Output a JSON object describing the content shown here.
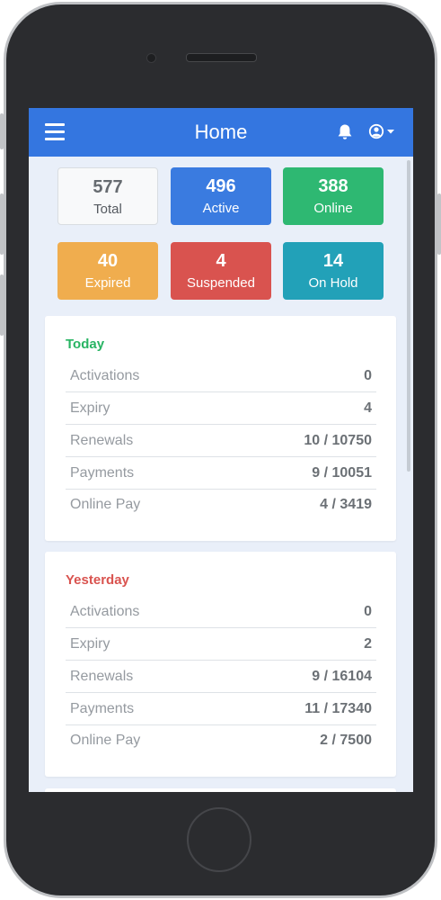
{
  "header": {
    "title": "Home"
  },
  "stats": [
    {
      "value": "577",
      "label": "Total"
    },
    {
      "value": "496",
      "label": "Active"
    },
    {
      "value": "388",
      "label": "Online"
    },
    {
      "value": "40",
      "label": "Expired"
    },
    {
      "value": "4",
      "label": "Suspended"
    },
    {
      "value": "14",
      "label": "On Hold"
    }
  ],
  "colors": {
    "navbar": "#3476e0",
    "active": "#3a7be0",
    "online": "#2eb872",
    "expired": "#f0ad4e",
    "suspended": "#d9534f",
    "on_hold": "#22a1b8",
    "today_title": "#28b463",
    "yesterday_title": "#d9534f"
  },
  "today": {
    "title": "Today",
    "rows": [
      {
        "label": "Activations",
        "value": "0"
      },
      {
        "label": "Expiry",
        "value": "4"
      },
      {
        "label": "Renewals",
        "value": "10 / 10750"
      },
      {
        "label": "Payments",
        "value": "9 / 10051"
      },
      {
        "label": "Online Pay",
        "value": "4 / 3419"
      }
    ]
  },
  "yesterday": {
    "title": "Yesterday",
    "rows": [
      {
        "label": "Activations",
        "value": "0"
      },
      {
        "label": "Expiry",
        "value": "2"
      },
      {
        "label": "Renewals",
        "value": "9 / 16104"
      },
      {
        "label": "Payments",
        "value": "11 / 17340"
      },
      {
        "label": "Online Pay",
        "value": "2 / 7500"
      }
    ]
  },
  "icons": {
    "menu": "hamburger-menu-icon",
    "notifications": "bell-icon",
    "account": "user-circle-icon",
    "dropdown": "caret-down-icon"
  }
}
